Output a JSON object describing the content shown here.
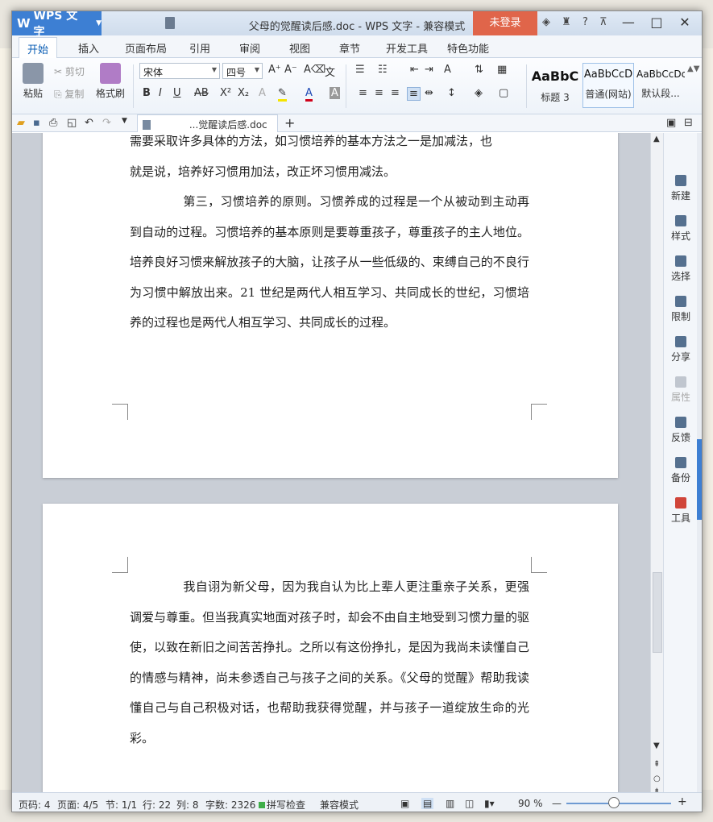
{
  "titlebar": {
    "app_label": "WPS 文字",
    "window_title": "父母的觉醒读后感.doc - WPS 文字 - 兼容模式",
    "login_label": "未登录",
    "icons": [
      "shield-icon",
      "shirt-icon",
      "help-icon",
      "collapse-icon"
    ],
    "controls": [
      "minimize-icon",
      "maximize-icon",
      "close-icon"
    ]
  },
  "tabs": [
    "开始",
    "插入",
    "页面布局",
    "引用",
    "审阅",
    "视图",
    "章节",
    "开发工具",
    "特色功能"
  ],
  "ribbon": {
    "paste": "粘贴",
    "cut": "剪切",
    "copy": "复制",
    "format_painter": "格式刷",
    "font_name": "宋体",
    "font_size": "四号",
    "styles": [
      {
        "preview": "AaBbC",
        "name": "标题 3"
      },
      {
        "preview": "AaBbCcD",
        "name": "普通(网站)"
      },
      {
        "preview": "AaBbCcDc",
        "name": "默认段..."
      }
    ]
  },
  "doc_tab": {
    "label": "...觉醒读后感.doc"
  },
  "document": {
    "page1": {
      "para1_line1": "需要采取许多具体的方法，如习惯培养的基本方法之一是加减法，也",
      "para1_line2": "就是说，培养好习惯用加法，改正坏习惯用减法。",
      "para2": "第三，习惯培养的原则。习惯养成的过程是一个从被动到主动再到自动的过程。习惯培养的基本原则是要尊重孩子，尊重孩子的主人地位。培养良好习惯来解放孩子的大脑，让孩子从一些低级的、束缚自己的不良行为习惯中解放出来。21 世纪是两代人相互学习、共同成长的世纪，习惯培养的过程也是两代人相互学习、共同成长的过程。"
    },
    "page2": {
      "para1": "我自诩为新父母，因为我自认为比上辈人更注重亲子关系，更强调爱与尊重。但当我真实地面对孩子时，却会不由自主地受到习惯力量的驱使，以致在新旧之间苦苦挣扎。之所以有这份挣扎，是因为我尚未读懂自己的情感与精神，尚未参透自己与孩子之间的关系。《父母的觉醒》帮助我读懂自己与自己积极对话，也帮助我获得觉醒，并与孩子一道绽放生命的光彩。"
    }
  },
  "sidepanel": [
    {
      "label": "新建",
      "icon": "new-doc-icon",
      "enabled": true
    },
    {
      "label": "样式",
      "icon": "style-icon",
      "enabled": true
    },
    {
      "label": "选择",
      "icon": "select-icon",
      "enabled": true
    },
    {
      "label": "限制",
      "icon": "restrict-icon",
      "enabled": true
    },
    {
      "label": "分享",
      "icon": "share-icon",
      "enabled": true
    },
    {
      "label": "属性",
      "icon": "properties-icon",
      "enabled": false
    },
    {
      "label": "反馈",
      "icon": "feedback-icon",
      "enabled": true
    },
    {
      "label": "备份",
      "icon": "backup-icon",
      "enabled": true
    },
    {
      "label": "工具",
      "icon": "toolbox-icon",
      "enabled": true
    }
  ],
  "statusbar": {
    "page_num": "页码: 4",
    "pages": "页面: 4/5",
    "section": "节: 1/1",
    "row": "行: 22",
    "col": "列: 8",
    "words": "字数: 2326",
    "spellcheck": "拼写检查",
    "mode": "兼容模式",
    "zoom": "90 %",
    "zoom_fraction": 0.45
  },
  "colors": {
    "accent": "#3d7fd3",
    "login": "#e0654a"
  }
}
